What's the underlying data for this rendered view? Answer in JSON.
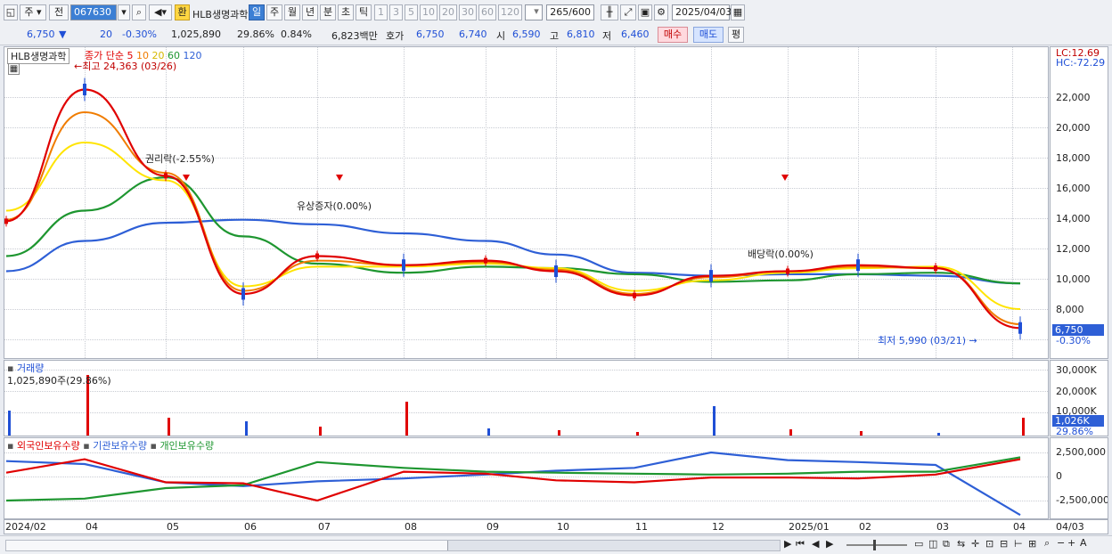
{
  "toolbar": {
    "period_label": "주",
    "prev_label": "전",
    "code_value": "067630",
    "fx_label": "환",
    "stock_name": "HLB생명과학",
    "period_tabs": [
      "일",
      "주",
      "월",
      "년",
      "분",
      "초",
      "틱"
    ],
    "interval_tabs": [
      "1",
      "3",
      "5",
      "10",
      "20",
      "30",
      "60",
      "120"
    ],
    "count_value": "265",
    "count_total": "/600",
    "date_value": "2025/04/03"
  },
  "quote": {
    "price": "6,750",
    "down_arrow": "▼",
    "change": "20",
    "change_pct": "-0.30%",
    "volume": "1,025,890",
    "turnover_pct": "29.86%",
    "ratio_pct": "0.84%",
    "trade_value": "6,823백만",
    "hoga_label": "호가",
    "ask": "6,750",
    "bid": "6,740",
    "open_label": "시",
    "open": "6,590",
    "high_label": "고",
    "high": "6,810",
    "low_label": "저",
    "low": "6,460",
    "buy_label": "매수",
    "sell_label": "매도",
    "eval_label": "평"
  },
  "price_panel": {
    "name_tag": "HLB생명과학",
    "ma_title": "종가 단순",
    "ma_periods": [
      {
        "label": "5",
        "color": "#e00000"
      },
      {
        "label": "10",
        "color": "#f07c00"
      },
      {
        "label": "20",
        "color": "#ffe400"
      },
      {
        "label": "60",
        "color": "#1e9630"
      },
      {
        "label": "120",
        "color": "#2e5fd6"
      }
    ],
    "high_note": "최고 24,363 (03/26)",
    "low_note": "최저 5,990 (03/21)",
    "events": [
      "권리락(-2.55%)",
      "유상증자(0.00%)",
      "배당락(0.00%)"
    ],
    "lc_label": "LC:12.69",
    "hc_label": "HC:-72.29",
    "last_price_tag": "6,750",
    "last_change_tag": "-0.30%",
    "y_ticks": [
      "22,000",
      "20,000",
      "18,000",
      "16,000",
      "14,000",
      "12,000",
      "10,000",
      "8,000"
    ]
  },
  "volume_panel": {
    "title": "거래량",
    "value_note": "1,025,890주(29.86%)",
    "y_ticks": [
      "30,000K",
      "20,000K",
      "10,000K"
    ],
    "last_tag": "1,026K",
    "last_pct": "29.86%"
  },
  "holder_panel": {
    "legend": [
      {
        "label": "외국인보유수량",
        "color": "#e00000"
      },
      {
        "label": "기관보유수량",
        "color": "#2e5fd6"
      },
      {
        "label": "개인보유수량",
        "color": "#1e9630"
      }
    ],
    "y_ticks": [
      "2,500,000",
      "0",
      "-2,500,000"
    ]
  },
  "x_axis": {
    "labels": [
      "2024/02",
      "04",
      "05",
      "06",
      "07",
      "08",
      "09",
      "10",
      "11",
      "12",
      "2025/01",
      "02",
      "03",
      "04"
    ],
    "right_label": "04/03"
  },
  "colors": {
    "up": "#e00000",
    "down": "#1f4fd6",
    "ma5": "#e00000",
    "ma10": "#f07c00",
    "ma20": "#ffe400",
    "ma60": "#1e9630",
    "ma120": "#2e5fd6"
  },
  "chart_data": {
    "type": "line",
    "title": "HLB생명과학",
    "x": [
      "2024/02",
      "04",
      "05",
      "06",
      "07",
      "08",
      "09",
      "10",
      "11",
      "12",
      "2025/01",
      "02",
      "03",
      "04"
    ],
    "ylim": [
      6000,
      23000
    ],
    "series": [
      {
        "name": "5",
        "values": [
          13800,
          22500,
          16800,
          9000,
          11500,
          10900,
          11200,
          10500,
          8900,
          10200,
          10500,
          10900,
          10700,
          6750
        ]
      },
      {
        "name": "10",
        "values": [
          13900,
          21000,
          17000,
          9200,
          11200,
          10900,
          11100,
          10600,
          9000,
          10100,
          10500,
          10800,
          10700,
          7000
        ]
      },
      {
        "name": "20",
        "values": [
          14500,
          19000,
          16500,
          9500,
          10800,
          10800,
          11000,
          10700,
          9200,
          9900,
          10400,
          10700,
          10800,
          8000
        ]
      },
      {
        "name": "60",
        "values": [
          11500,
          14500,
          16700,
          12800,
          11000,
          10400,
          10800,
          10700,
          10300,
          9800,
          9900,
          10300,
          10400,
          9700
        ]
      },
      {
        "name": "120",
        "values": [
          10500,
          12500,
          13700,
          13900,
          13600,
          13000,
          12500,
          11600,
          10400,
          10200,
          10300,
          10300,
          10200,
          9700
        ]
      }
    ]
  }
}
